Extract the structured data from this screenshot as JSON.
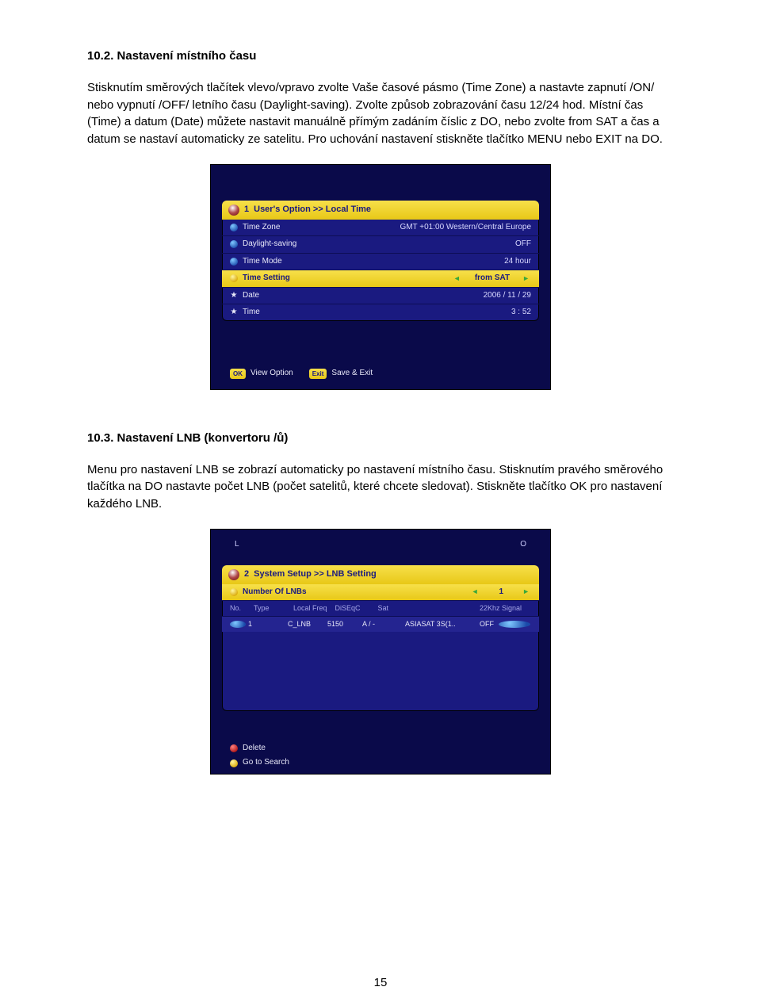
{
  "section1": {
    "title": "10.2. Nastavení místního času",
    "para": "Stisknutím směrových tlačítek vlevo/vpravo zvolte Vaše časové pásmo (Time Zone) a nastavte zapnutí /ON/ nebo vypnutí /OFF/ letního času (Daylight-saving). Zvolte způsob zobrazování času 12/24 hod. Místní čas (Time) a datum (Date) můžete nastavit manuálně přímým zadáním číslic z DO, nebo zvolte from SAT a čas a datum se nastaví automaticky ze satelitu. Pro uchování nastavení stiskněte tlačítko MENU nebo EXIT na DO.",
    "screenshot": {
      "breadcrumb_num": "1",
      "breadcrumb": "User's Option >> Local Time",
      "rows": [
        {
          "label": "Time Zone",
          "value": "GMT +01:00 Western/Central Europe",
          "icon": "blue"
        },
        {
          "label": "Daylight-saving",
          "value": "OFF",
          "icon": "blue"
        },
        {
          "label": "Time Mode",
          "value": "24 hour",
          "icon": "blue"
        },
        {
          "label": "Time Setting",
          "value": "from SAT",
          "icon": "yellow",
          "selected": true,
          "arrows": true
        },
        {
          "label": "Date",
          "value": "2006 / 11 / 29",
          "icon": "star"
        },
        {
          "label": "Time",
          "value": "3 : 52",
          "icon": "star"
        }
      ],
      "footer": [
        {
          "btn": "OK",
          "text": "View Option"
        },
        {
          "btn": "Exit",
          "text": "Save & Exit"
        }
      ]
    }
  },
  "section2": {
    "title": "10.3. Nastavení LNB (konvertoru /ů)",
    "para": "Menu pro nastavení LNB se zobrazí automaticky po nastavení místního času. Stisknutím pravého směrového tlačítka na DO nastavte počet LNB (počet satelitů, které chcete sledovat). Stiskněte tlačítko OK pro nastavení každého LNB.",
    "screenshot": {
      "lo_markers": {
        "l": "L",
        "o": "O"
      },
      "breadcrumb_num": "2",
      "breadcrumb": "System Setup >> LNB Setting",
      "row_label": "Number Of LNBs",
      "row_value_left": "◄",
      "row_value": "1",
      "row_value_right": "►",
      "table_headers": [
        "No.",
        "Type",
        "Local Freq",
        "DiSEqC",
        "Sat",
        "22Khz Signal"
      ],
      "table_row": [
        "1",
        "C_LNB",
        "5150",
        "A / -",
        "ASIASAT 3S(1..",
        "OFF"
      ],
      "footer": [
        {
          "icon": "red",
          "text": "Delete"
        },
        {
          "icon": "yellow",
          "text": "Go to Search"
        }
      ]
    }
  },
  "page_number": "15"
}
